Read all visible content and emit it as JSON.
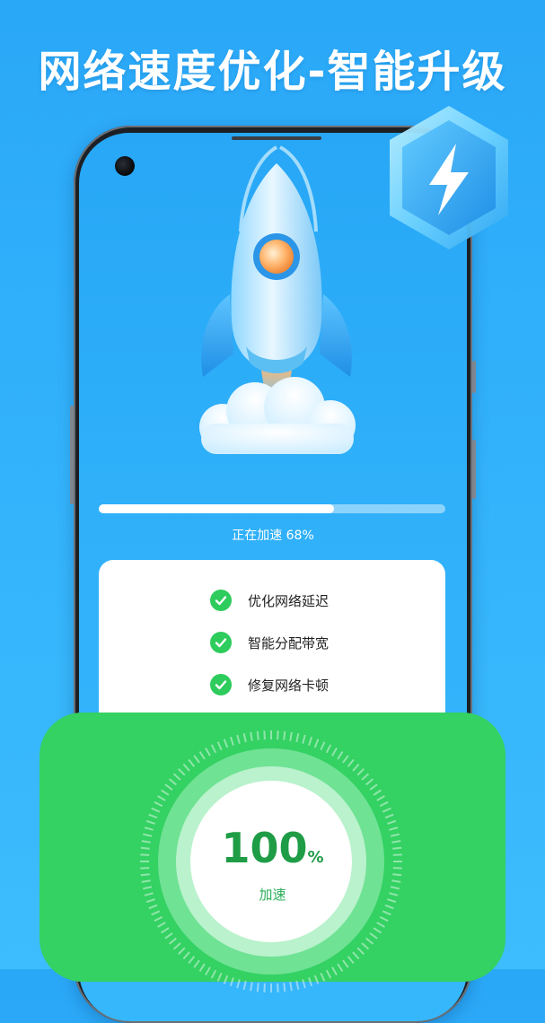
{
  "headline": "网络速度优化-智能升级",
  "boost": {
    "progress_percent": 68,
    "status_label": "正在加速 68%"
  },
  "checklist": [
    {
      "label": "优化网络延迟",
      "icon": "check-circle-icon",
      "done": true
    },
    {
      "label": "智能分配带宽",
      "icon": "check-circle-icon",
      "done": true
    },
    {
      "label": "修复网络卡顿",
      "icon": "check-circle-icon",
      "done": true
    }
  ],
  "result": {
    "value": "100",
    "unit": "%",
    "label": "加速"
  },
  "icons": {
    "hero": "rocket-icon",
    "badge": "lightning-bolt-icon",
    "camera": "front-camera-icon"
  },
  "colors": {
    "background": "#2aa8f8",
    "accent_green": "#34d163",
    "check_green": "#2dcc5c",
    "result_text": "#1f9c46"
  }
}
